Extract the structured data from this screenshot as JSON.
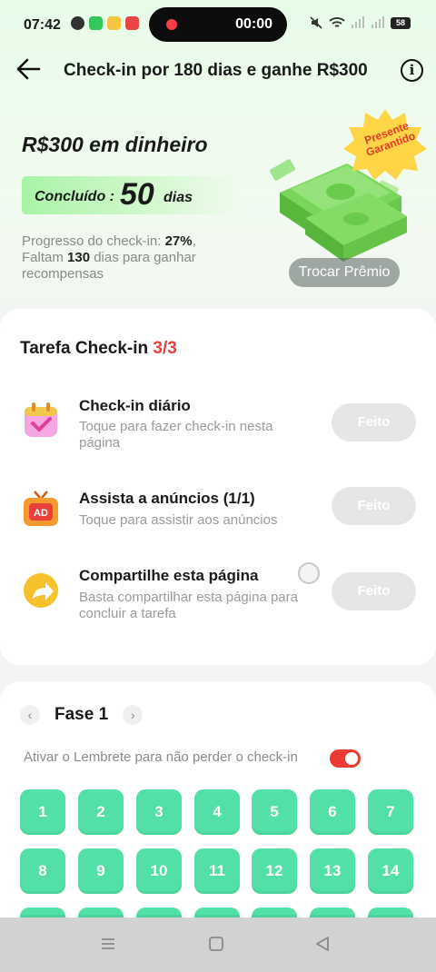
{
  "status_bar": {
    "time": "07:42",
    "recording_time": "00:00",
    "battery": "58"
  },
  "header": {
    "title": "Check-in por 180 dias e ganhe R$300",
    "back_icon": "arrow-left-icon",
    "info_icon": "info-icon"
  },
  "hero": {
    "reward_title": "R$300 em dinheiro",
    "completed_label": "Concluído :",
    "completed_days": "50",
    "completed_unit": "dias",
    "progress_label": "Progresso do check-in: ",
    "progress_percent": "27%",
    "progress_suffix": ",",
    "remaining_prefix": "Faltam ",
    "remaining_days": "130",
    "remaining_suffix": " dias para ganhar recompensas",
    "badge_text": "Presente Garantido",
    "redeem_button": "Trocar Prêmio"
  },
  "tasks": {
    "title": "Tarefa Check-in ",
    "count": "3/3",
    "items": [
      {
        "name": "Check-in diário",
        "sub": "Toque para fazer check-in nesta página",
        "button": "Feito",
        "icon": "calendar-check-icon"
      },
      {
        "name": "Assista a anúncios  (1/1)",
        "sub": "Toque para assistir aos anúncios",
        "button": "Feito",
        "icon": "ad-tv-icon"
      },
      {
        "name": "Compartilhe esta página",
        "sub": "Basta compartilhar esta página para concluir a tarefa",
        "button": "Feito",
        "icon": "share-arrow-icon"
      }
    ]
  },
  "phase": {
    "label": "Fase 1",
    "reminder_text": "Ativar o Lembrete para não perder o check-in",
    "reminder_on": true,
    "days": [
      "1",
      "2",
      "3",
      "4",
      "5",
      "6",
      "7",
      "8",
      "9",
      "10",
      "11",
      "12",
      "13",
      "14"
    ]
  },
  "colors": {
    "accent_green": "#52e0a6",
    "accent_red": "#e8413a",
    "done_button": "#e6e6e6"
  }
}
